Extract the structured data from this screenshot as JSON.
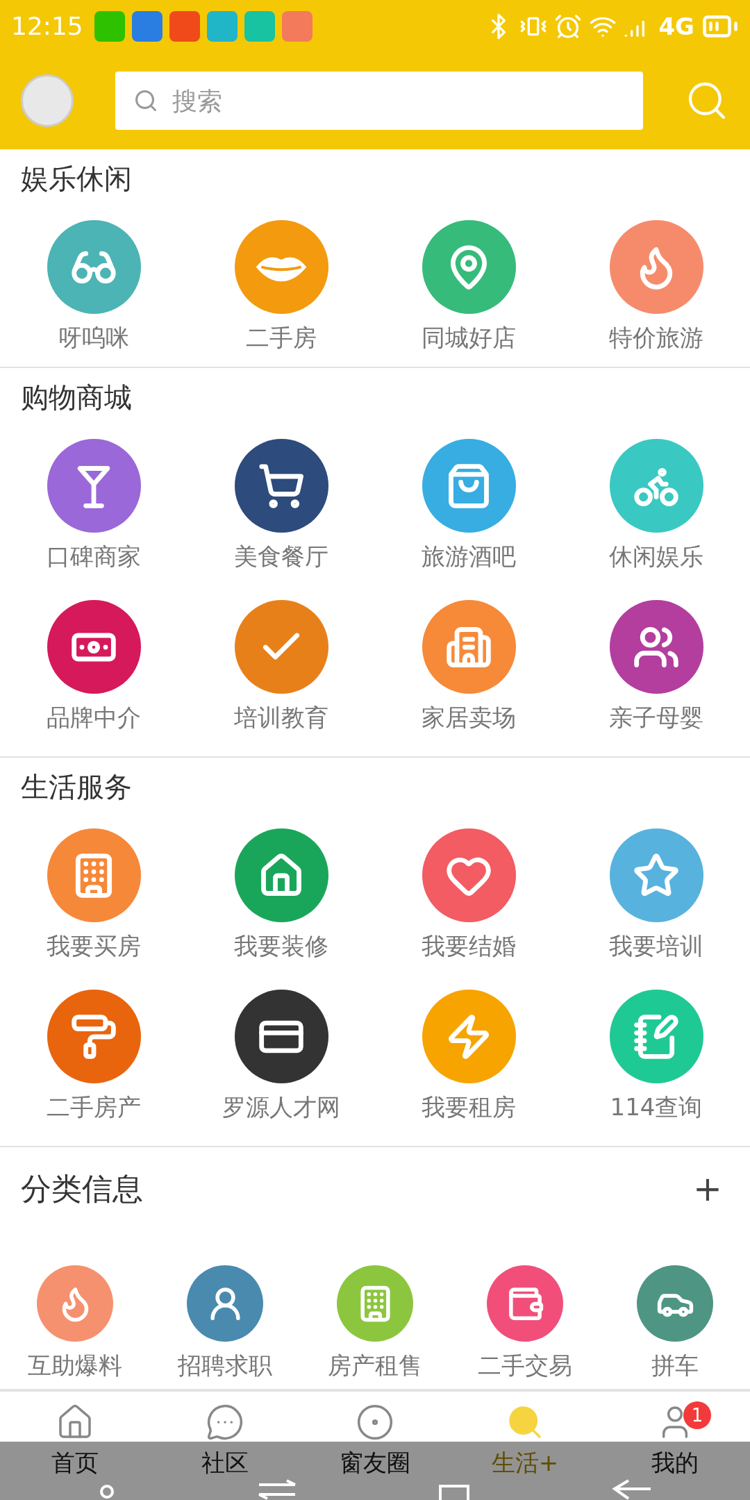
{
  "status_bar": {
    "time": "12:15",
    "network": "4G",
    "notifications": [
      {
        "color": "#2dc100"
      },
      {
        "color": "#2a7de1"
      },
      {
        "color": "#f04a1a"
      },
      {
        "color": "#21b5c8"
      },
      {
        "color": "#17c3a0"
      },
      {
        "color": "#f47a5c"
      }
    ]
  },
  "header": {
    "search": {
      "placeholder": "搜索"
    }
  },
  "sections": [
    {
      "title": "娱乐休闲",
      "items": [
        {
          "label": "呀呜咪",
          "color": "#4cb4b4"
        },
        {
          "label": "二手房",
          "color": "#f39a0e"
        },
        {
          "label": "同城好店",
          "color": "#36bb7b"
        },
        {
          "label": "特价旅游",
          "color": "#f68b6c"
        }
      ]
    },
    {
      "title": "购物商城",
      "items": [
        {
          "label": "口碑商家",
          "color": "#9a68d8"
        },
        {
          "label": "美食餐厅",
          "color": "#2d4b7c"
        },
        {
          "label": "旅游酒吧",
          "color": "#37ade2"
        },
        {
          "label": "休闲娱乐",
          "color": "#3ac8c2"
        },
        {
          "label": "品牌中介",
          "color": "#d6195a"
        },
        {
          "label": "培训教育",
          "color": "#e8801a"
        },
        {
          "label": "家居卖场",
          "color": "#f68a38"
        },
        {
          "label": "亲子母婴",
          "color": "#b33e9e"
        }
      ]
    },
    {
      "title": "生活服务",
      "items": [
        {
          "label": "我要买房",
          "color": "#f6883a"
        },
        {
          "label": "我要装修",
          "color": "#1aa65a"
        },
        {
          "label": "我要结婚",
          "color": "#f25c62"
        },
        {
          "label": "我要培训",
          "color": "#58b2de"
        },
        {
          "label": "二手房产",
          "color": "#e8650e"
        },
        {
          "label": "罗源人才网",
          "color": "#333333"
        },
        {
          "label": "我要租房",
          "color": "#f7a400"
        },
        {
          "label": "114查询",
          "color": "#1fc994"
        }
      ]
    }
  ],
  "classified": {
    "title": "分类信息",
    "add": "+",
    "items": [
      {
        "label": "互助爆料",
        "color": "#f5916e"
      },
      {
        "label": "招聘求职",
        "color": "#4a8aaf"
      },
      {
        "label": "房产租售",
        "color": "#8cc63f"
      },
      {
        "label": "二手交易",
        "color": "#f14f7a"
      },
      {
        "label": "拼车",
        "color": "#4e9584"
      }
    ]
  },
  "tabs": [
    {
      "label": "首页",
      "selected": false
    },
    {
      "label": "社区",
      "selected": false
    },
    {
      "label": "窗友圈",
      "selected": false
    },
    {
      "label": "生活+",
      "selected": true
    },
    {
      "label": "我的",
      "selected": false,
      "badge": "1"
    }
  ]
}
